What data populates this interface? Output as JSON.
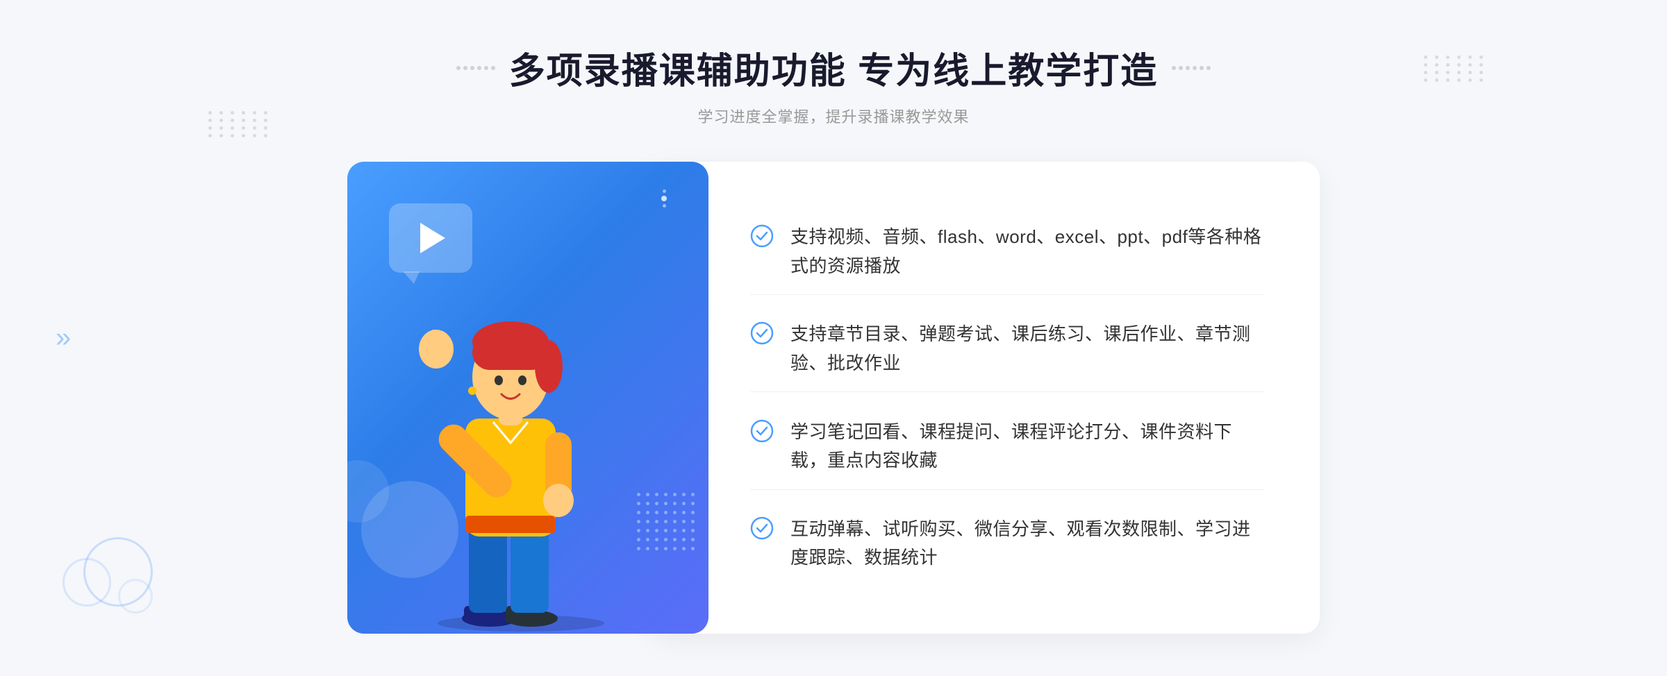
{
  "page": {
    "background_color": "#f5f7fa"
  },
  "header": {
    "main_title": "多项录播课辅助功能 专为线上教学打造",
    "sub_title": "学习进度全掌握，提升录播课教学效果"
  },
  "features": [
    {
      "id": 1,
      "text": "支持视频、音频、flash、word、excel、ppt、pdf等各种格式的资源播放"
    },
    {
      "id": 2,
      "text": "支持章节目录、弹题考试、课后练习、课后作业、章节测验、批改作业"
    },
    {
      "id": 3,
      "text": "学习笔记回看、课程提问、课程评论打分、课件资料下载，重点内容收藏"
    },
    {
      "id": 4,
      "text": "互动弹幕、试听购买、微信分享、观看次数限制、学习进度跟踪、数据统计"
    }
  ],
  "decorations": {
    "arrow_left": "»",
    "check_symbol": "✓"
  }
}
